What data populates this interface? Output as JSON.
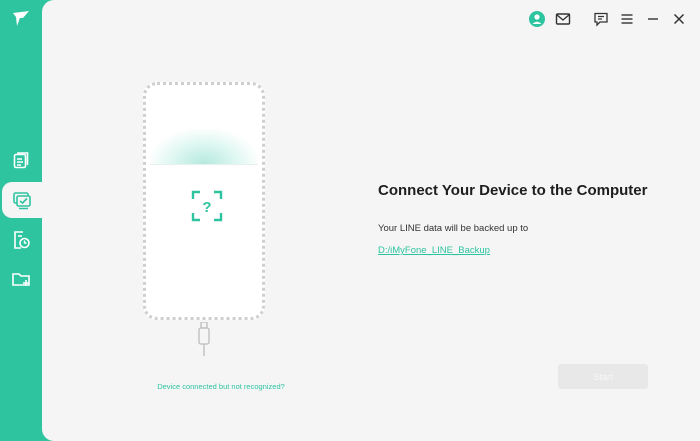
{
  "app": {
    "accent_color": "#2ec4a0",
    "logo_icon": "imyfone-logo-icon"
  },
  "sidebar": {
    "items": [
      {
        "icon": "document-icon",
        "active": false
      },
      {
        "icon": "backup-monitor-icon",
        "active": true
      },
      {
        "icon": "restore-icon",
        "active": false
      },
      {
        "icon": "export-folder-icon",
        "active": false
      }
    ]
  },
  "titlebar": {
    "buttons": [
      "user-avatar-icon",
      "mail-icon",
      "feedback-icon",
      "menu-icon",
      "minimize-icon",
      "close-icon"
    ]
  },
  "phone": {
    "status_icon": "unknown-device-icon",
    "help_link": "Device connected but not recognized?"
  },
  "content": {
    "heading": "Connect Your Device to the Computer",
    "subtext": "Your LINE data will be backed up to",
    "backup_path": "D:/iMyFone_LINE_Backup"
  },
  "actions": {
    "start_label": "Start",
    "start_enabled": false
  }
}
